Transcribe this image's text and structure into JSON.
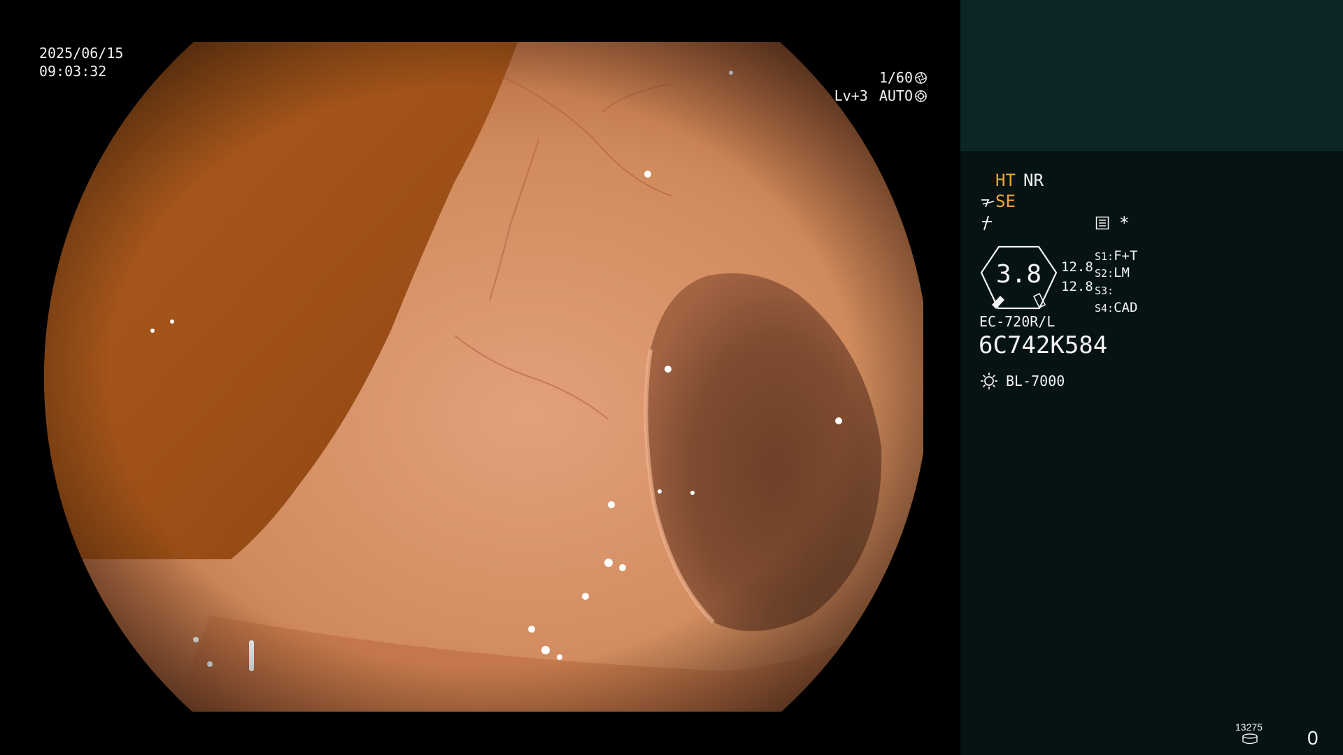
{
  "osd": {
    "date": "2025/06/15",
    "time": "09:03:32",
    "shutter": "1/60",
    "shutter_icon": "shutter-icon",
    "exposure_level": "Lv+3",
    "exposure_mode": "AUTO",
    "exposure_icon": "iris-icon"
  },
  "panel": {
    "ht": "HT",
    "nr": "NR",
    "se": "SE",
    "asterisk": "*",
    "iris_value": "3.8",
    "value_a": "12.8",
    "value_b": "12.8",
    "slots": [
      {
        "label": "S1:",
        "value": "F+T"
      },
      {
        "label": "S2:",
        "value": "LM"
      },
      {
        "label": "S3:",
        "value": ""
      },
      {
        "label": "S4:",
        "value": "CAD"
      }
    ],
    "scope_model": "EC-720R/L",
    "scope_serial": "6C742K584",
    "light_source": "BL-7000",
    "counter": "13275",
    "count": "0"
  },
  "colors": {
    "accent_orange": "#f1a63a",
    "panel_bg": "#061313",
    "panel_top_bg": "#0c2628",
    "text": "#f2f2f2"
  }
}
